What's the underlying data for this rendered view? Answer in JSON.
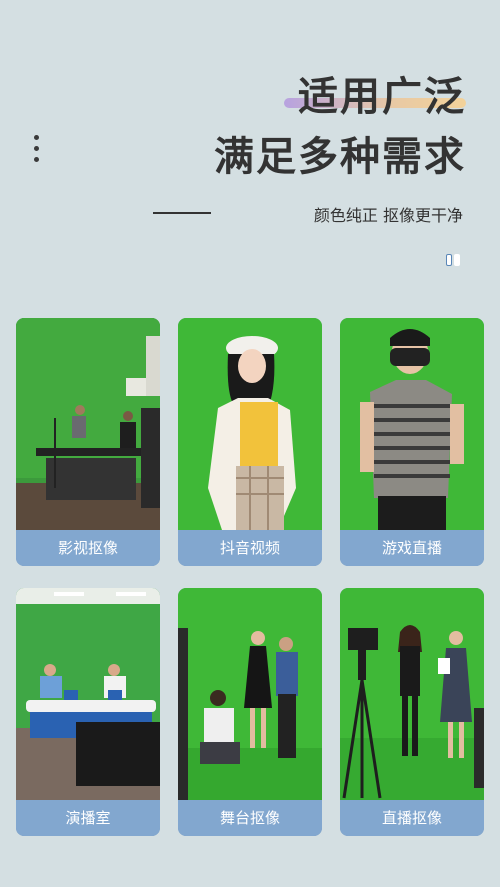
{
  "header": {
    "title_line1": "适用广泛",
    "title_line2": "满足多种需求",
    "subtitle": "颜色纯正 抠像更干净"
  },
  "colors": {
    "background": "#d4dfe2",
    "label_bar": "#82a7cf",
    "green_screen": "#3fb837",
    "highlight_start": "#b7a2e0",
    "highlight_end": "#f3d29a"
  },
  "cards": [
    {
      "label": "影视抠像"
    },
    {
      "label": "抖音视频"
    },
    {
      "label": "游戏直播"
    },
    {
      "label": "演播室"
    },
    {
      "label": "舞台抠像"
    },
    {
      "label": "直播抠像"
    }
  ]
}
